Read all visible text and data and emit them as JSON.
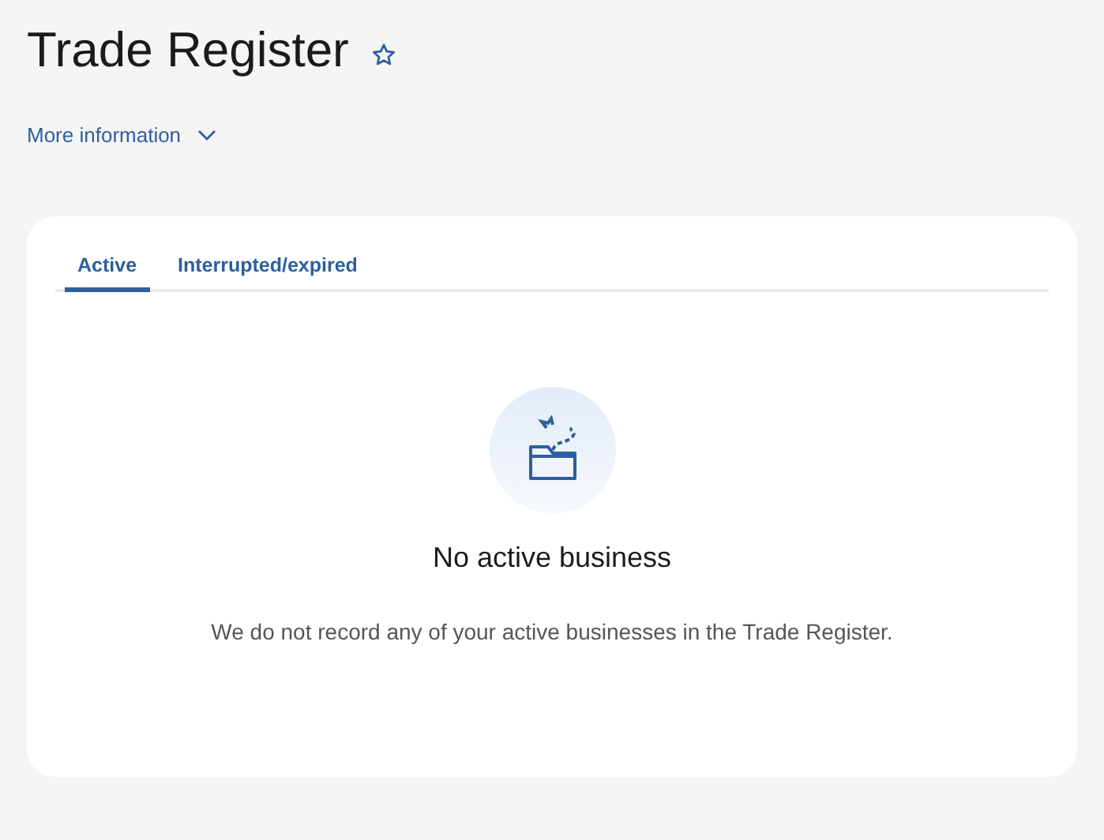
{
  "page": {
    "title": "Trade Register",
    "favorite": false,
    "more_info": {
      "label": "More information",
      "expanded": false
    }
  },
  "tabs": [
    {
      "label": "Active",
      "selected": true
    },
    {
      "label": "Interrupted/expired",
      "selected": false
    }
  ],
  "empty_state": {
    "title": "No active business",
    "message": "We do not record any of your active businesses in the Trade Register."
  }
}
